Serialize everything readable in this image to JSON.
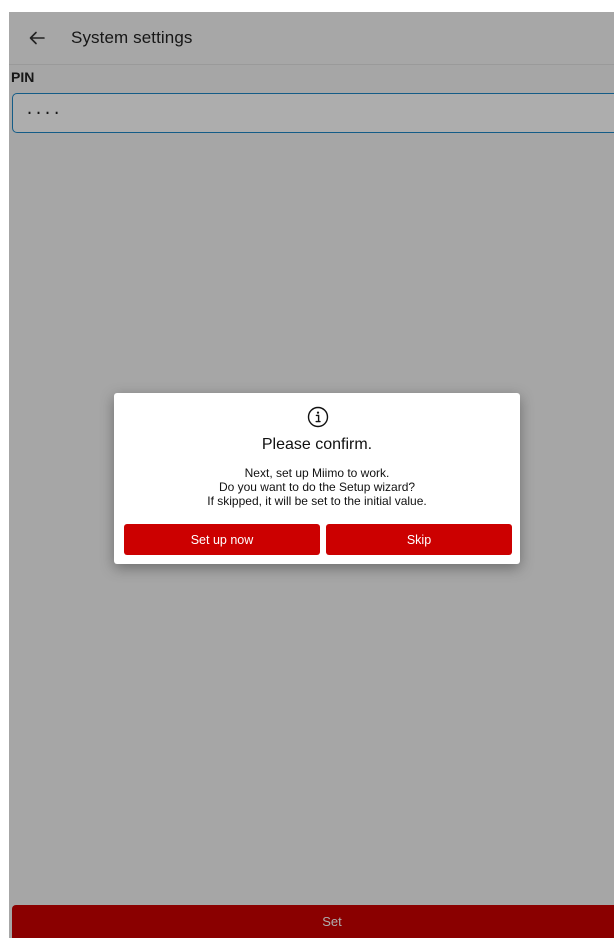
{
  "header": {
    "title": "System settings",
    "back_icon": "arrow-left-icon"
  },
  "form": {
    "pin_label": "PIN",
    "pin_value": "····"
  },
  "footer": {
    "set_label": "Set"
  },
  "dialog": {
    "icon": "info-icon",
    "title": "Please confirm.",
    "message_lines": [
      "Next, set up Miimo to work.",
      "Do you want to do the Setup wizard?",
      "If skipped, it will be set to the initial value."
    ],
    "primary_label": "Set up now",
    "secondary_label": "Skip"
  },
  "colors": {
    "accent_red": "#cc0000",
    "focus_blue": "#1e88c8"
  }
}
